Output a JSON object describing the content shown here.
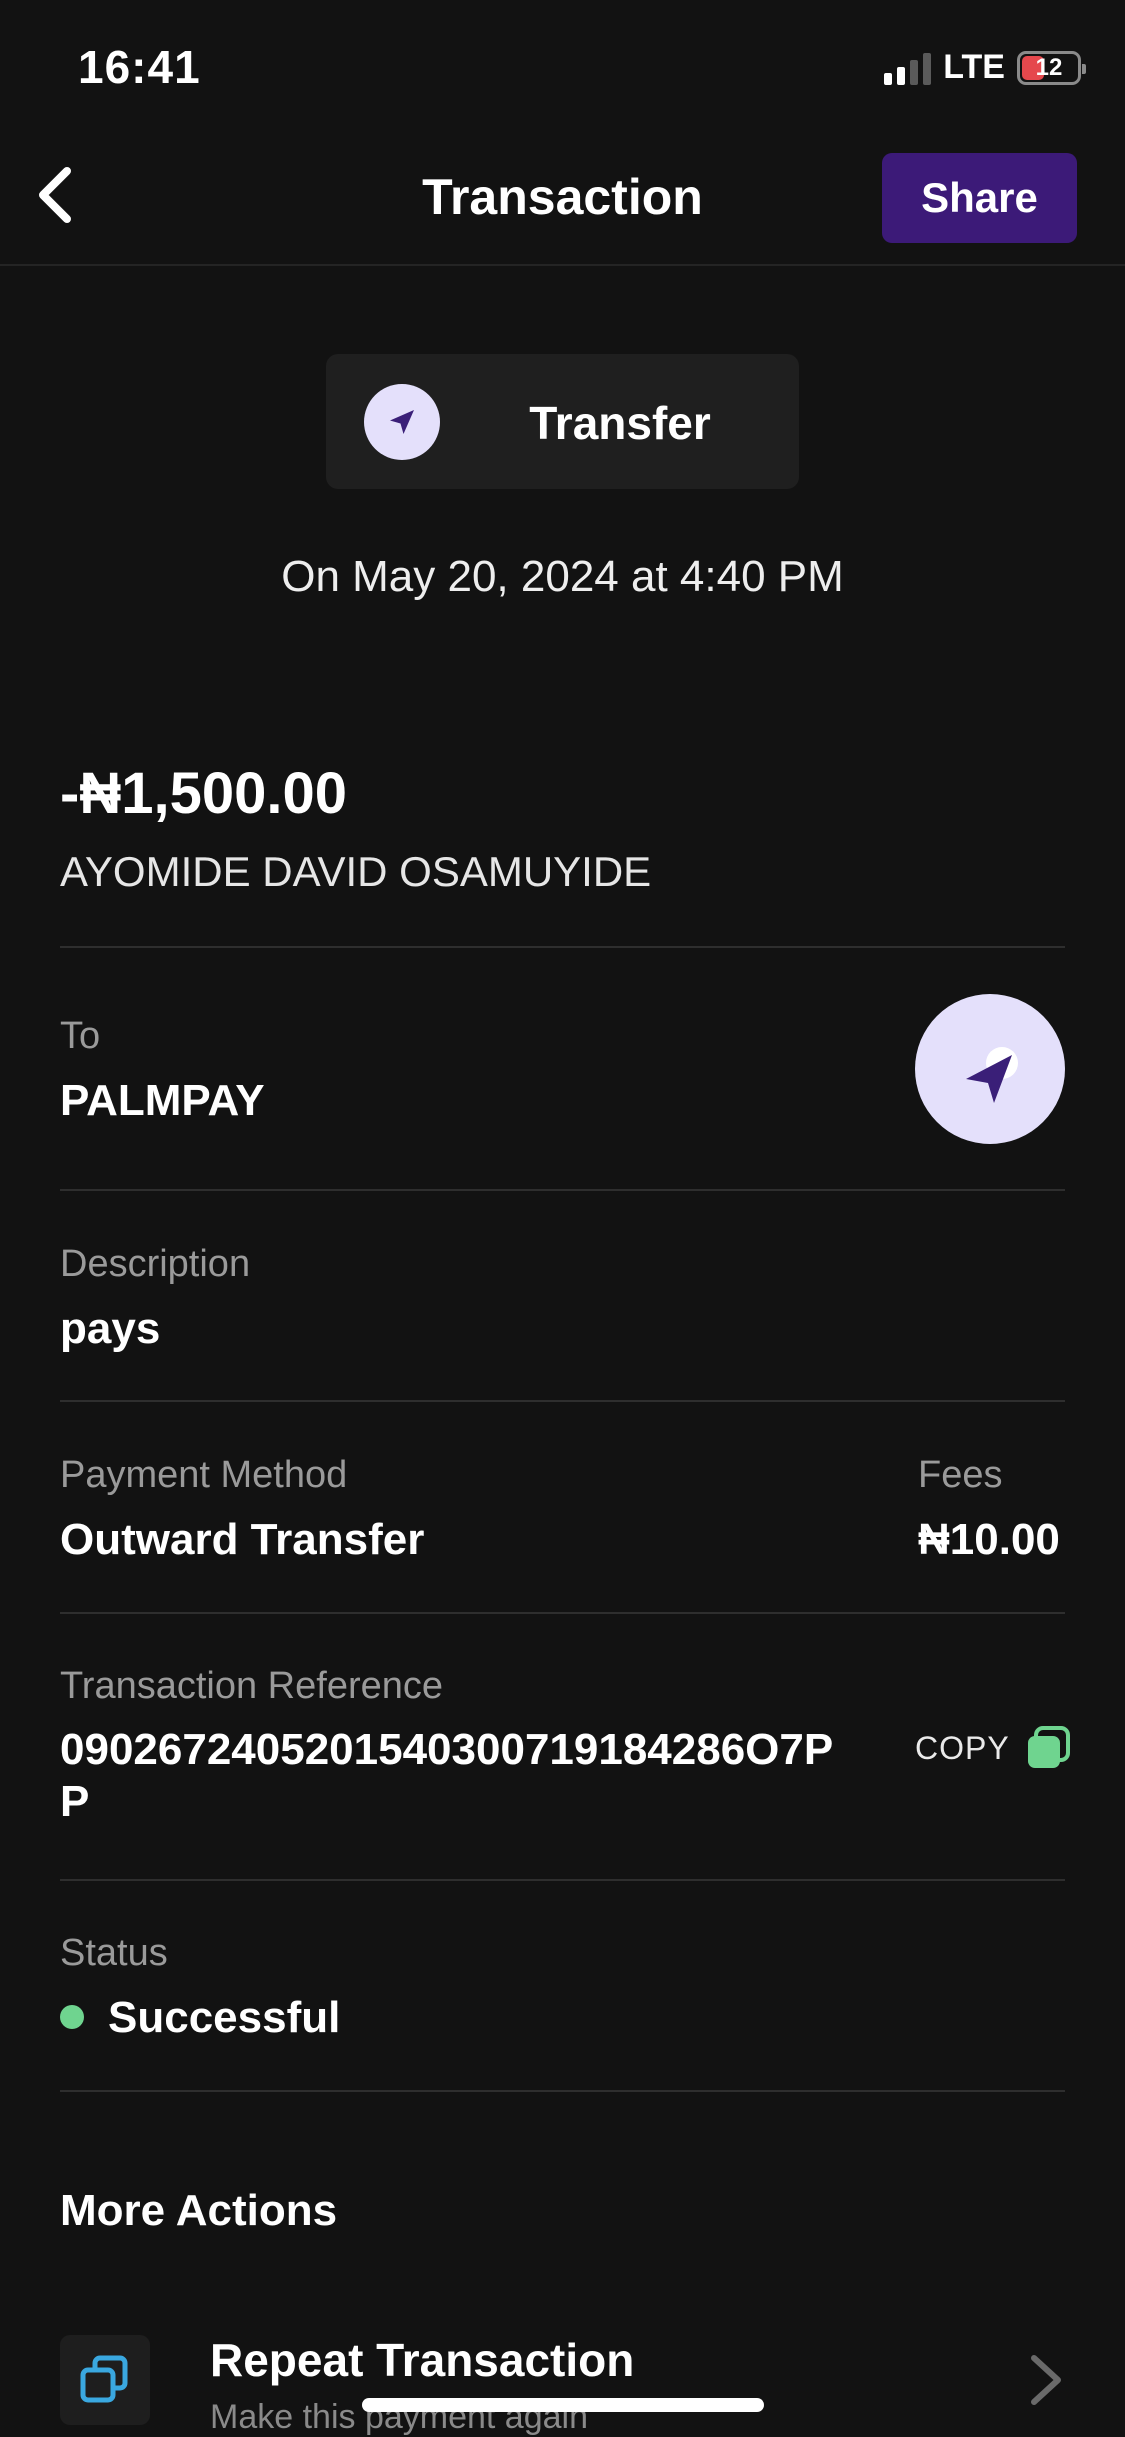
{
  "status_bar": {
    "time": "16:41",
    "network": "LTE",
    "battery": "12"
  },
  "header": {
    "title": "Transaction",
    "share_label": "Share"
  },
  "transaction_type": {
    "label": "Transfer",
    "icon": "send-arrow-icon"
  },
  "date_text": "On May 20, 2024 at 4:40 PM",
  "amount": "-₦1,500.00",
  "sender_name": "AYOMIDE DAVID OSAMUYIDE",
  "to": {
    "label": "To",
    "value": "PALMPAY"
  },
  "description": {
    "label": "Description",
    "value": "pays"
  },
  "payment_method": {
    "label": "Payment Method",
    "value": "Outward Transfer"
  },
  "fees": {
    "label": "Fees",
    "value": "₦10.00"
  },
  "reference": {
    "label": "Transaction Reference",
    "value": "0902672405201540300719184286O7PP",
    "copy_label": "COPY"
  },
  "status": {
    "label": "Status",
    "value": "Successful",
    "color": "#6fd48f"
  },
  "more_actions": {
    "title": "More Actions",
    "repeat": {
      "title": "Repeat Transaction",
      "subtitle": "Make this payment again"
    }
  },
  "colors": {
    "background": "#121212",
    "accent": "#3c1a78",
    "icon_bg": "#e4e0fb",
    "icon_fg": "#3a1f78",
    "copy_green": "#6fd48f",
    "repeat_icon": "#3aa8e0"
  }
}
